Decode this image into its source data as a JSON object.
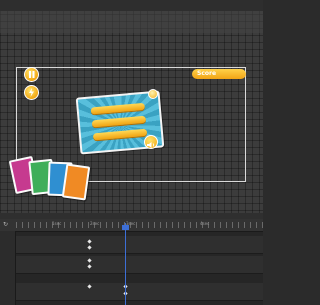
{
  "canvas": {
    "score_label": "Score",
    "buttons": [
      {
        "name": "pause-button",
        "icon": "pause-icon"
      },
      {
        "name": "lightning-button",
        "icon": "lightning-icon"
      }
    ]
  },
  "dialog": {
    "buttons": [
      "",
      "",
      ""
    ],
    "close_icon": "close-icon",
    "sound_icon": "sound-icon"
  },
  "cards": [
    {
      "color": "#c63a8f"
    },
    {
      "color": "#3fae5a"
    },
    {
      "color": "#2f8fd1"
    },
    {
      "color": "#f08a24"
    }
  ],
  "timeline": {
    "refresh_icon": "refresh-icon",
    "ruler_labels": [
      "1sec",
      "2sec",
      "3sec",
      "4sec"
    ],
    "rows": [
      "",
      "",
      "",
      "",
      "",
      ""
    ],
    "colors": {
      "playhead": "#3d6fd6",
      "keyframe": "#e6e6e6"
    }
  },
  "colors": {
    "accent": "#f2a814",
    "dialog_bg": "#3ea8c8",
    "canvas_bg": "#3c3c3c"
  }
}
